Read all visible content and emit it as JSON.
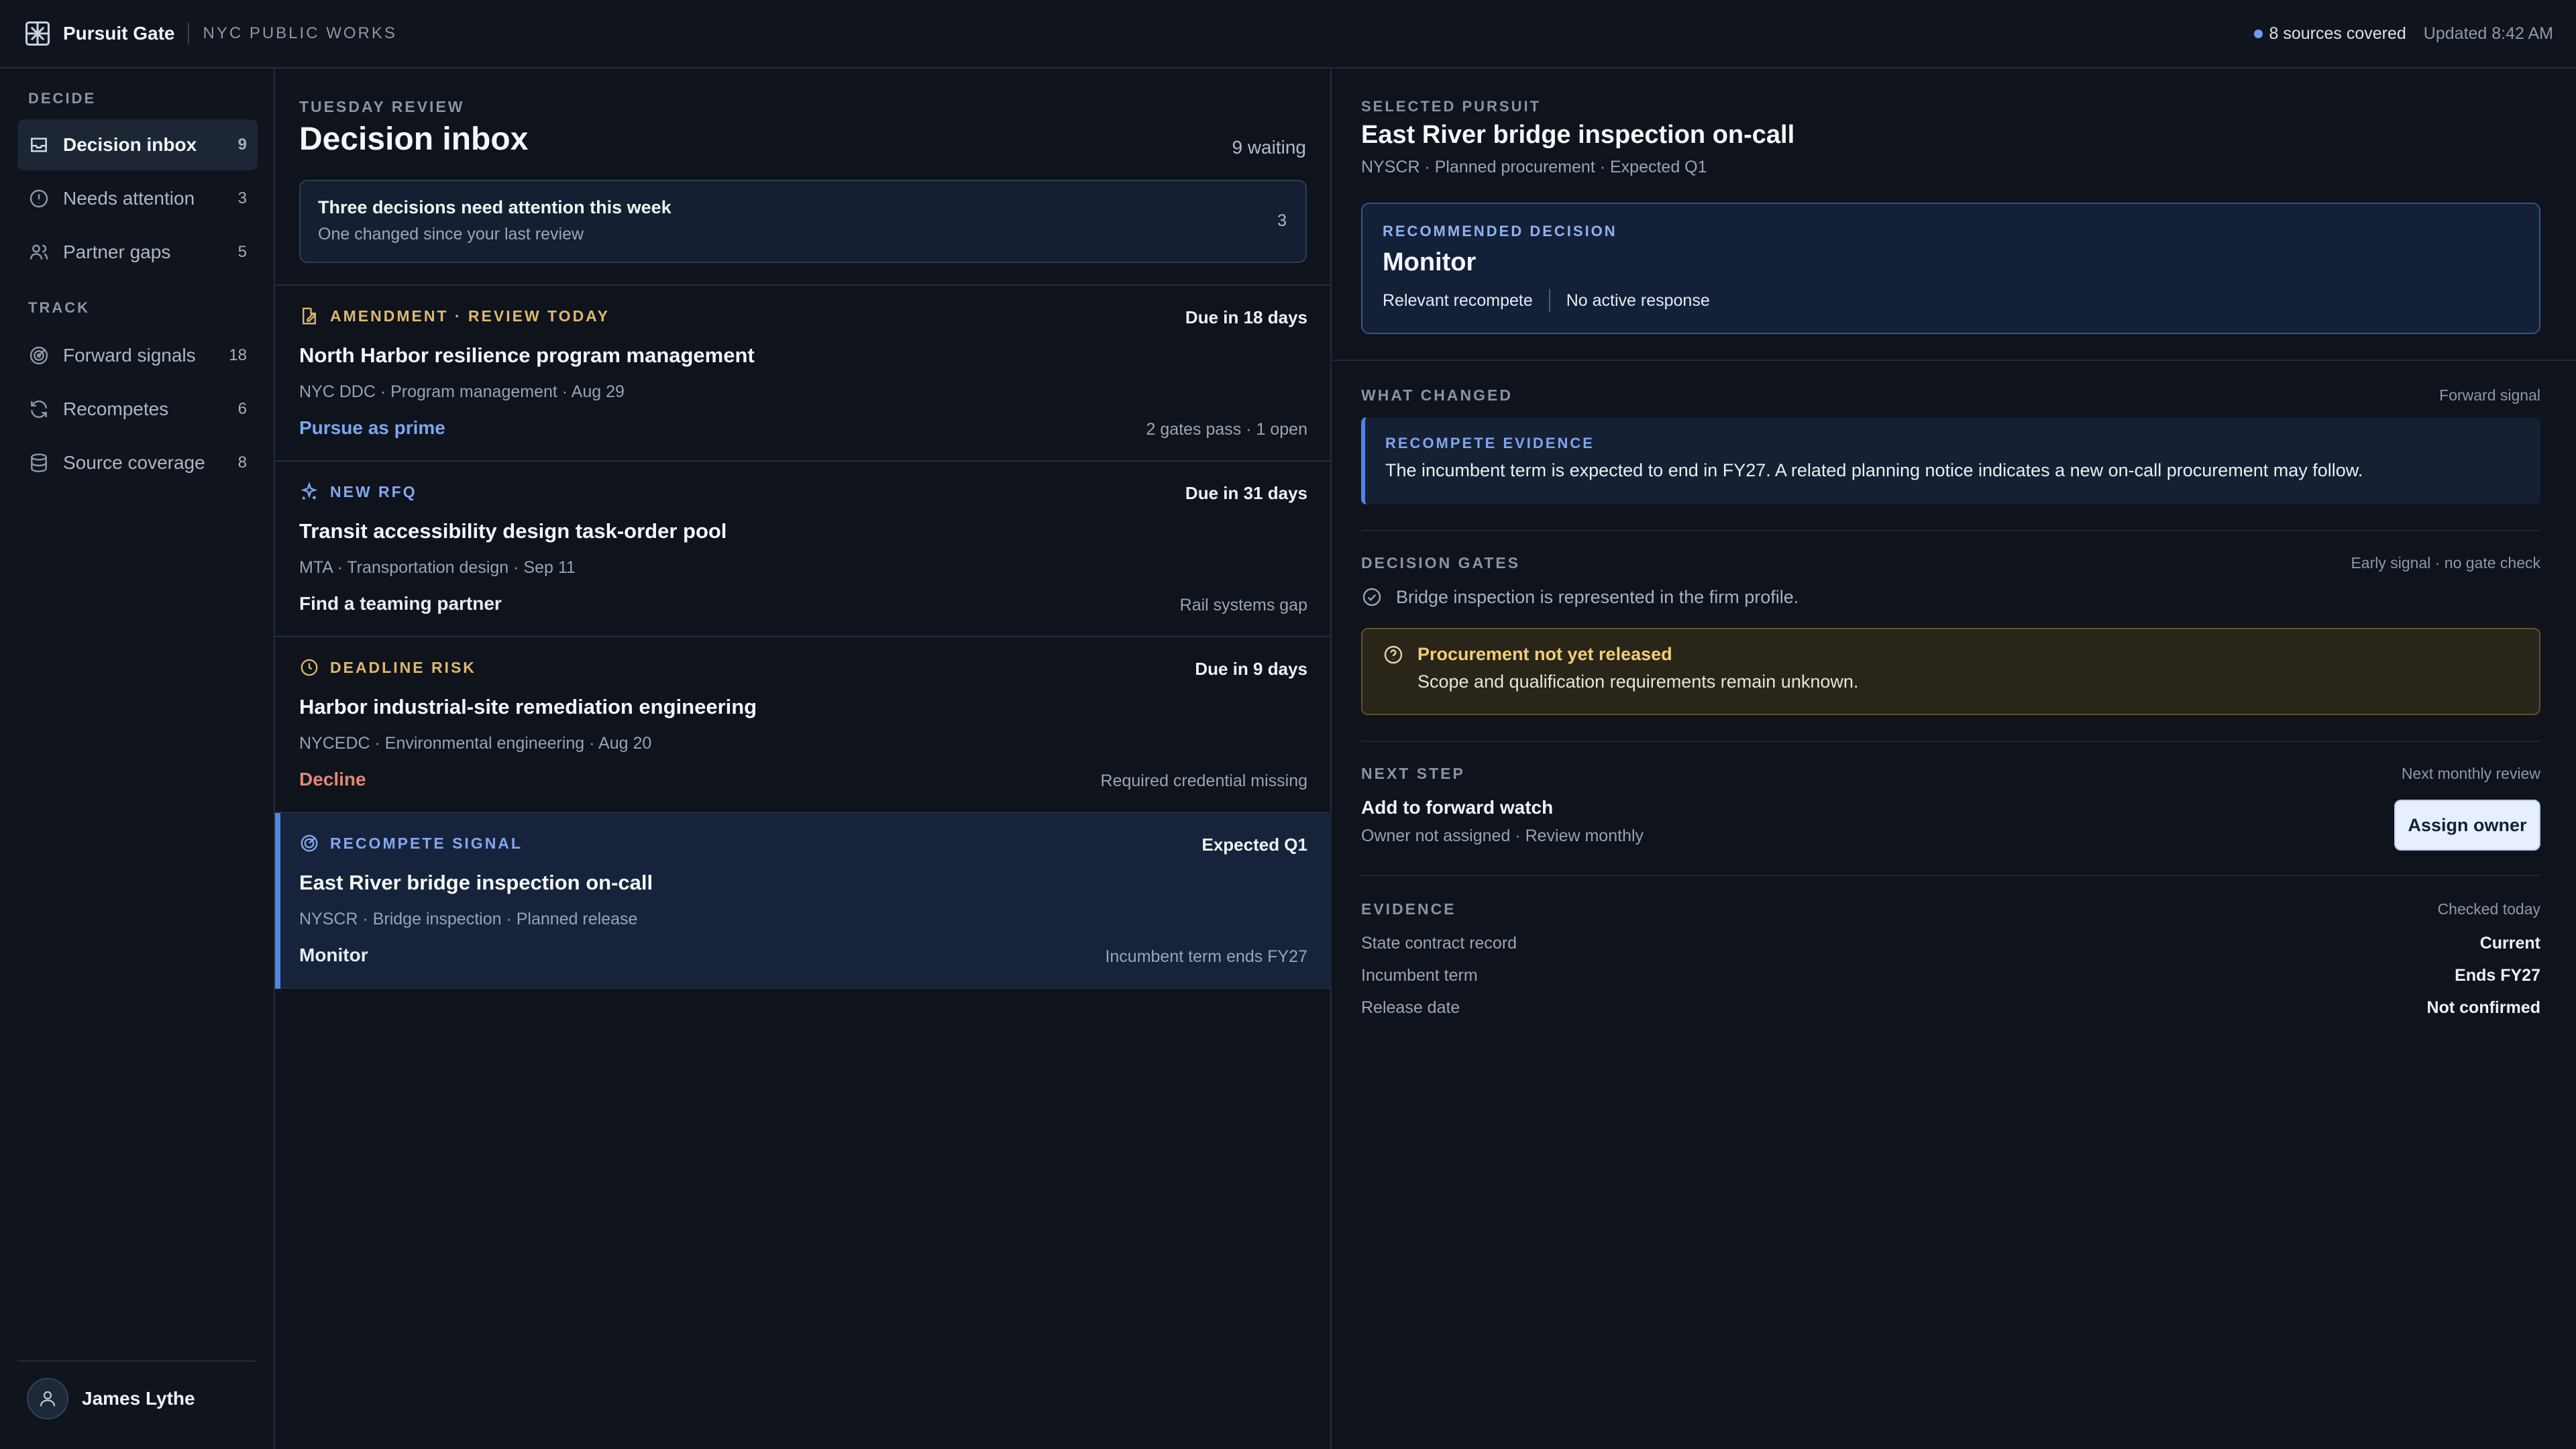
{
  "topbar": {
    "brand": "Pursuit Gate",
    "org": "NYC PUBLIC WORKS",
    "sources": "8 sources covered",
    "updated": "Updated 8:42 AM",
    "accent": "#4f86e6"
  },
  "sidebar": {
    "decide_label": "DECIDE",
    "track_label": "TRACK",
    "items": [
      {
        "label": "Decision inbox",
        "count": "9",
        "icon": "inbox-icon"
      },
      {
        "label": "Needs attention",
        "count": "3",
        "icon": "alert-circle-icon"
      },
      {
        "label": "Partner gaps",
        "count": "5",
        "icon": "people-icon"
      },
      {
        "label": "Forward signals",
        "count": "18",
        "icon": "radar-icon"
      },
      {
        "label": "Recompetes",
        "count": "6",
        "icon": "refresh-icon"
      },
      {
        "label": "Source coverage",
        "count": "8",
        "icon": "database-icon"
      }
    ],
    "user": "James Lythe"
  },
  "inbox": {
    "kicker": "TUESDAY REVIEW",
    "title": "Decision inbox",
    "waiting": "9 waiting",
    "summary": {
      "heading": "Three decisions need attention this week",
      "sub": "One changed since your last review",
      "count": "3"
    },
    "cards": [
      {
        "tag": "AMENDMENT · REVIEW TODAY",
        "due": "Due in 18 days",
        "title": "North Harbor resilience program management",
        "meta": "NYC DDC · Program management · Aug 29",
        "action": "Pursue as prime",
        "note": "2 gates pass · 1 open"
      },
      {
        "tag": "NEW RFQ",
        "due": "Due in 31 days",
        "title": "Transit accessibility design task-order pool",
        "meta": "MTA · Transportation design · Sep 11",
        "action": "Find a teaming partner",
        "note": "Rail systems gap"
      },
      {
        "tag": "DEADLINE RISK",
        "due": "Due in 9 days",
        "title": "Harbor industrial-site remediation engineering",
        "meta": "NYCEDC · Environmental engineering · Aug 20",
        "action": "Decline",
        "note": "Required credential missing"
      },
      {
        "tag": "RECOMPETE SIGNAL",
        "due": "Expected Q1",
        "title": "East River bridge inspection on-call",
        "meta": "NYSCR · Bridge inspection · Planned release",
        "action": "Monitor",
        "note": "Incumbent term ends FY27"
      }
    ]
  },
  "detail": {
    "kicker": "SELECTED PURSUIT",
    "title": "East River bridge inspection on-call",
    "meta": "NYSCR · Planned procurement · Expected Q1",
    "recommendation": {
      "label": "RECOMMENDED DECISION",
      "decision": "Monitor",
      "chip1": "Relevant recompete",
      "chip2": "No active response"
    },
    "what_changed": {
      "label": "WHAT CHANGED",
      "right": "Forward signal",
      "evidence_label": "RECOMPETE EVIDENCE",
      "evidence_text": "The incumbent term is expected to end in FY27. A related planning notice indicates a new on-call procurement may follow."
    },
    "gates": {
      "label": "DECISION GATES",
      "right": "Early signal · no gate check",
      "check": "Bridge inspection is represented in the firm profile.",
      "warn_title": "Procurement not yet released",
      "warn_text": "Scope and qualification requirements remain unknown."
    },
    "next_step": {
      "label": "NEXT STEP",
      "right": "Next monthly review",
      "action": "Add to forward watch",
      "sub": "Owner not assigned · Review monthly",
      "button": "Assign owner"
    },
    "evidence": {
      "label": "EVIDENCE",
      "right": "Checked today",
      "rows": [
        {
          "label": "State contract record",
          "value": "Current"
        },
        {
          "label": "Incumbent term",
          "value": "Ends FY27"
        },
        {
          "label": "Release date",
          "value": "Not confirmed"
        }
      ]
    }
  }
}
